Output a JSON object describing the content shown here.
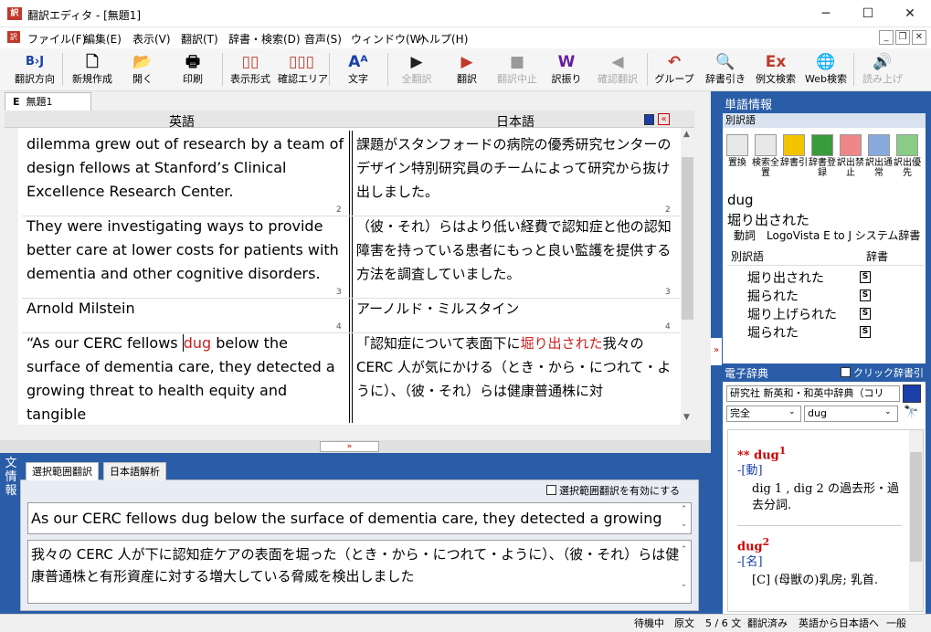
{
  "window": {
    "title": "翻訳エディタ - [無題1]",
    "min": "─",
    "max": "☐",
    "close": "✕"
  },
  "menu": {
    "items": [
      "ファイル(F)",
      "編集(E)",
      "表示(V)",
      "翻訳(T)",
      "辞書・検索(D)",
      "音声(S)",
      "ウィンドウ(W)",
      "ヘルプ(H)"
    ]
  },
  "toolbar": {
    "buttons": [
      {
        "label": "翻訳方向",
        "icon": "B›J"
      },
      {
        "label": "新規作成",
        "icon": "🗋"
      },
      {
        "label": "開く",
        "icon": "📂"
      },
      {
        "label": "印刷",
        "icon": "🖶"
      },
      {
        "label": "表示形式",
        "icon": "▯▯"
      },
      {
        "label": "確認エリア",
        "icon": "▯▯▯"
      },
      {
        "label": "文字",
        "icon": "Aᴬ"
      },
      {
        "label": "全翻訳",
        "icon": "▶"
      },
      {
        "label": "翻訳",
        "icon": "▶"
      },
      {
        "label": "翻訳中止",
        "icon": "■"
      },
      {
        "label": "訳振り",
        "icon": "W"
      },
      {
        "label": "確認翻訳",
        "icon": "◀"
      },
      {
        "label": "グループ",
        "icon": "↶"
      },
      {
        "label": "辞書引き",
        "icon": "🔍"
      },
      {
        "label": "例文検索",
        "icon": "Ex"
      },
      {
        "label": "Web検索",
        "icon": "🌐"
      },
      {
        "label": "読み上げ",
        "icon": "🔊"
      }
    ]
  },
  "document": {
    "tab": "無題1",
    "tab_prefix": "E",
    "header_en": "英語",
    "header_ja": "日本語"
  },
  "segments": [
    {
      "num": "",
      "en": "dilemma grew out of research by a team of design fellows at Stanford’s Clinical Excellence Research Center.",
      "ja": "課題がスタンフォードの病院の優秀研究センターのデザイン特別研究員のチームによって研究から抜け出しました。"
    },
    {
      "num": "2",
      "en": "They were investigating ways to provide better care at lower costs for patients with dementia and other cognitive disorders.",
      "ja": "（彼・それ）らはより低い経費で認知症と他の認知障害を持っている患者にもっと良い監護を提供する方法を調査していました。"
    },
    {
      "num": "3",
      "en": "Arnold Milstein",
      "ja": "アーノルド・ミルスタイン"
    },
    {
      "num": "4",
      "en_pre": "“As our CERC fellows ",
      "en_hl": "dug",
      "en_post": " below the surface of dementia care, they detected a growing threat to health equity and tangible",
      "ja_pre": "「認知症について表面下に",
      "ja_hl": "堀り出された",
      "ja_post": "我々のCERC 人が気にかける（とき・から・につれて・ように）、（彼・それ）らは健康普通株に対"
    }
  ],
  "bottom": {
    "vertical_label": "文情報",
    "tabs": [
      "選択範囲翻訳",
      "日本語解析"
    ],
    "checkbox_label": "選択範囲翻訳を有効にする",
    "source": "As our CERC fellows dug below the surface of dementia care, they detected a growing",
    "target": "我々の CERC 人が下に認知症ケアの表面を堀った（とき・から・につれて・ように）、（彼・それ）らは健康普通株と有形資産に対する増大している脅威を検出しました"
  },
  "word_info": {
    "title": "単語情報",
    "subtitle": "別訳語",
    "tools": [
      {
        "label": "置換"
      },
      {
        "label": "検索全置"
      },
      {
        "label": "辞書引"
      },
      {
        "label": "辞書登録"
      },
      {
        "label": "訳出禁止"
      },
      {
        "label": "訳出通常"
      },
      {
        "label": "訳出優先"
      }
    ],
    "word": "dug",
    "translation": "堀り出された",
    "info": "動詞　LogoVista E to J システム辞書",
    "list_header": "別訳語",
    "list_header2": "辞書",
    "alternatives": [
      "堀り出された",
      "掘られた",
      "堀り上げられた",
      "堀られた"
    ],
    "dict_mark": "S"
  },
  "edict": {
    "title": "電子辞典",
    "checkbox": "クリック辞書引",
    "dictionary": "研究社 新英和・和英中辞典（コリ",
    "mode": "完全",
    "query": "dug",
    "entry1_head": "** dug",
    "entry1_sup": "1",
    "entry1_pos": "-[動]",
    "entry1_body": "dig 1 , dig 2 の過去形・過去分詞.",
    "entry2_head": "dug",
    "entry2_sup": "2",
    "entry2_pos": "-[名]",
    "entry2_body": "[C] (母獣の)乳房; 乳首."
  },
  "status": {
    "items": [
      "待機中",
      "原文",
      "5 / 6 文",
      "翻訳済み",
      "英語から日本語へ",
      "一般"
    ]
  }
}
